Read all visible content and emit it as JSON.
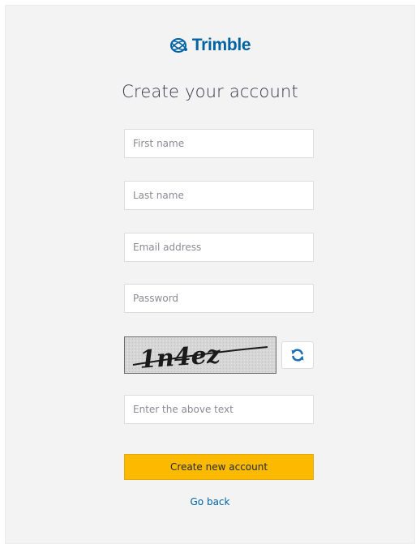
{
  "brand": {
    "name": "Trimble",
    "color": "#0063a3"
  },
  "page": {
    "title": "Create your account"
  },
  "form": {
    "first_name": {
      "placeholder": "First name",
      "value": ""
    },
    "last_name": {
      "placeholder": "Last name",
      "value": ""
    },
    "email": {
      "placeholder": "Email address",
      "value": ""
    },
    "password": {
      "placeholder": "Password",
      "value": ""
    },
    "captcha": {
      "image_text": "1n4ez",
      "refresh_icon": "refresh-icon",
      "input_placeholder": "Enter the above text",
      "value": ""
    },
    "submit_label": "Create new account",
    "submit_color": "#fbba00",
    "back_label": "Go back"
  }
}
